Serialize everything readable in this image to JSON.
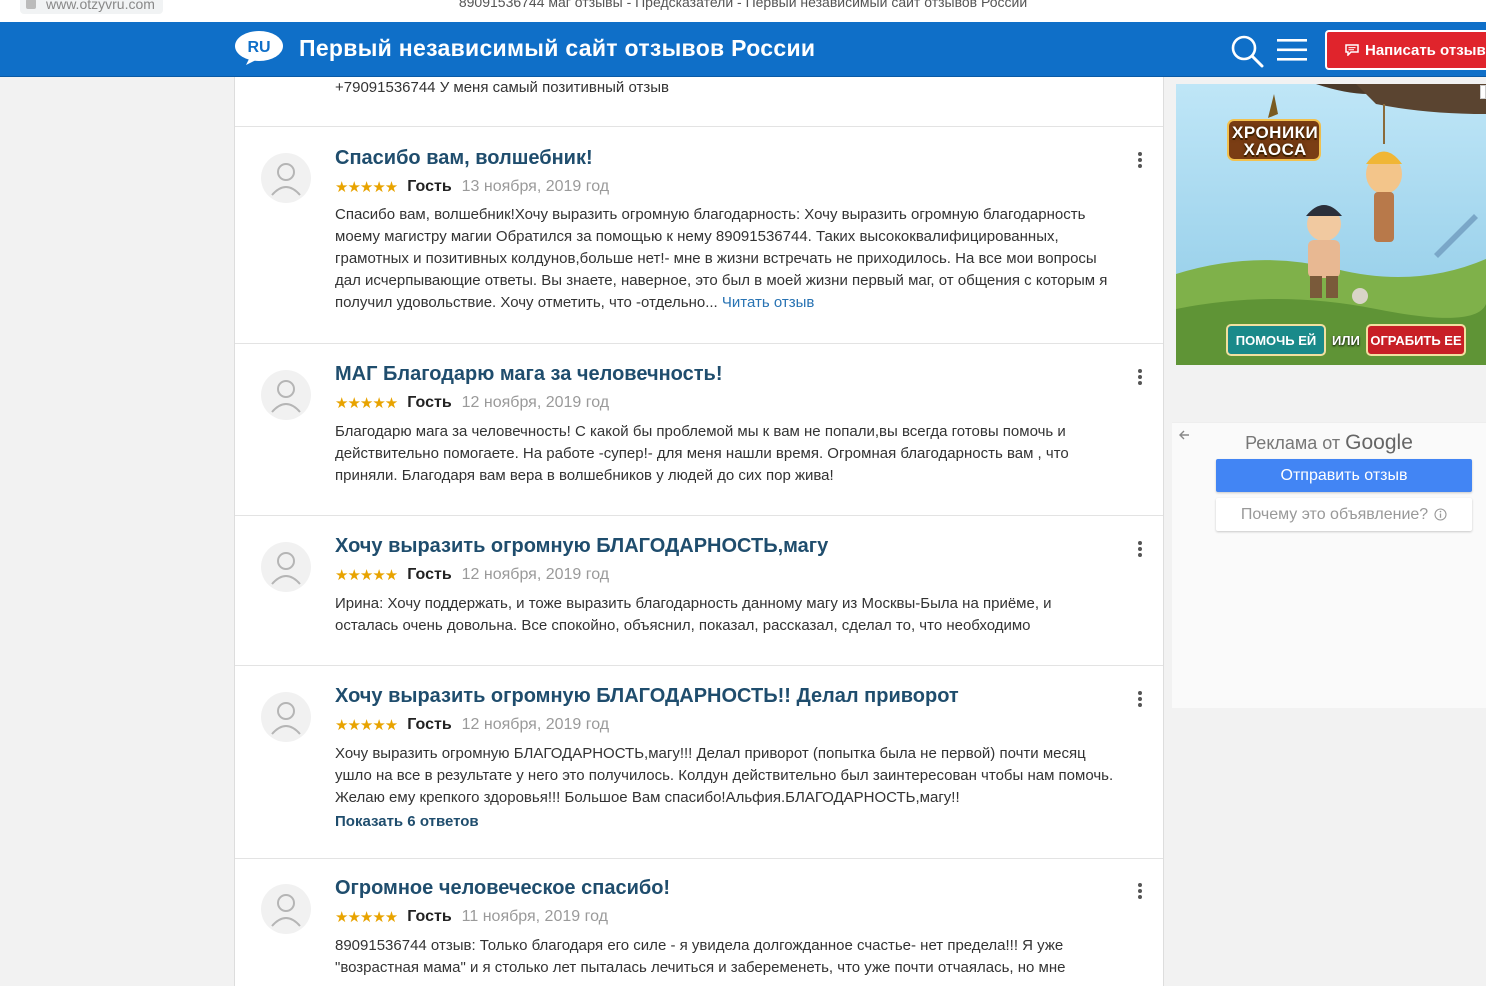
{
  "browser": {
    "url": "www.otzyvru.com",
    "title": "89091536744 маг отзывы - Предсказатели - Первый независимый сайт отзывов России"
  },
  "header": {
    "logo_text": "RU",
    "site_title": "Первый независимый сайт отзывов России",
    "write_button": "Написать отзыв"
  },
  "top_snippet": "+79091536744 У меня самый позитивный отзыв",
  "reviews": [
    {
      "title": "Спасибо вам, волшебник!",
      "stars": "★★★★★",
      "author": "Гость",
      "date": "13 ноября, 2019 год",
      "lines": [
        "Спасибо вам, волшебник!Хочу выразить огромную благодарность: Хочу выразить огромную благодарность",
        "моему магистру магии Обратился за помощью к нему 89091536744. Таких высококвалифицированных,",
        "грамотных и позитивных колдунов,больше нет!- мне в жизни встречать не приходилось. На все мои вопросы",
        "дал исчерпывающие ответы. Вы знаете, наверное, это был в моей жизни первый маг, от общения с которым я",
        "получил удовольствие. Хочу отметить, что -отдельно..."
      ],
      "read_more": "Читать отзыв"
    },
    {
      "title": "МАГ Благодарю мага за человечность!",
      "stars": "★★★★★",
      "author": "Гость",
      "date": "12 ноября, 2019 год",
      "lines": [
        "Благодарю мага за человечность! С какой бы проблемой мы к вам не попали,вы всегда готовы помочь и",
        "действительно помогаете. На работе -супер!- для меня нашли время. Огромная благодарность вам , что",
        "приняли. Благодаря вам вера в волшебников у людей до сих пор жива!"
      ]
    },
    {
      "title": "Хочу выразить огромную БЛАГОДАРНОСТЬ,магу",
      "stars": "★★★★★",
      "author": "Гость",
      "date": "12 ноября, 2019 год",
      "lines": [
        "Ирина: Хочу поддержать, и тоже выразить благодарность данному магу из Москвы-Была на приёме, и",
        "осталась очень довольна. Все спокойно, объяснил, показал, рассказал, сделал то, что необходимо"
      ]
    },
    {
      "title": "Хочу выразить огромную БЛАГОДАРНОСТЬ!! Делал приворот",
      "stars": "★★★★★",
      "author": "Гость",
      "date": "12 ноября, 2019 год",
      "lines": [
        "Хочу выразить огромную БЛАГОДАРНОСТЬ,магу!!! Делал приворот (попытка была не первой) почти месяц",
        "ушло на все в результате у него это получилось. Колдун действительно был заинтересован чтобы нам помочь.",
        "Желаю ему крепкого здоровья!!! Большое Вам спасибо!Альфия.БЛАГОДАРНОСТЬ,магу!!"
      ],
      "replies": "Показать 6 ответов"
    },
    {
      "title": "Огромное человеческое спасибо!",
      "stars": "★★★★★",
      "author": "Гость",
      "date": "11 ноября, 2019 год",
      "lines": [
        "89091536744 отзыв: Только благодаря его силе - я увидела долгожданное счастье- нет предела!!! Я уже",
        "\"возрастная мама\" и я столько лет пыталась лечиться и забеременеть, что уже почти отчаялась, но мне"
      ]
    }
  ],
  "ad": {
    "title_line1": "ХРОНИКИ",
    "title_line2": "ХАОСА",
    "help_button": "ПОМОЧЬ ЕЙ",
    "or": "ИЛИ",
    "rob_button": "ОГРАБИТЬ ЕЕ"
  },
  "google": {
    "label": "Реклама от",
    "brand": "Google",
    "send_button": "Отправить отзыв",
    "why_button": "Почему это объявление?"
  },
  "colors": {
    "header_blue": "#0f6fc8",
    "write_red": "#e0242c",
    "title_blue": "#1f4d6d",
    "link_blue": "#2873b3",
    "star_gold": "#e8a300",
    "google_blue": "#4285f4"
  }
}
